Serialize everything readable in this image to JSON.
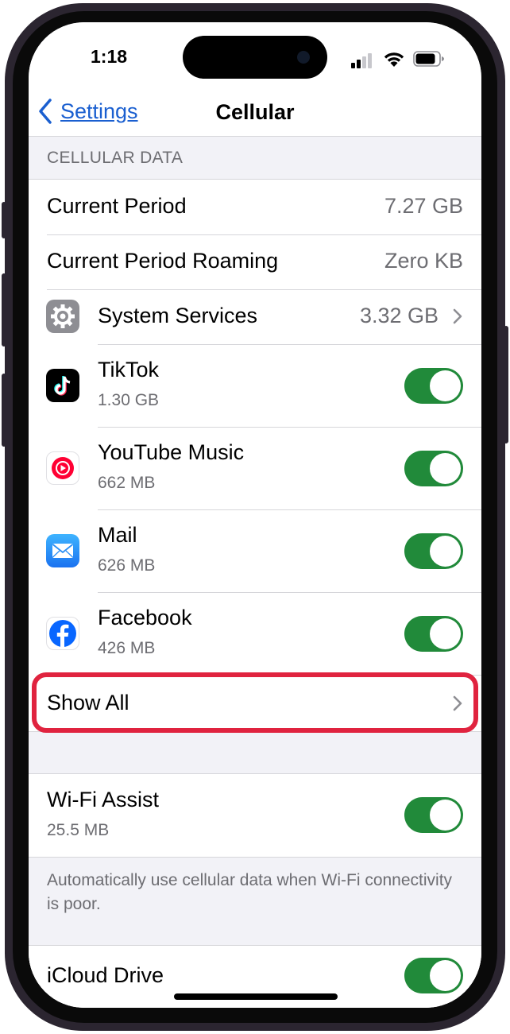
{
  "status_bar": {
    "time": "1:18"
  },
  "nav": {
    "back_label": "Settings",
    "title": "Cellular"
  },
  "section_header": "CELLULAR DATA",
  "usage_rows": [
    {
      "label": "Current Period",
      "value": "7.27 GB"
    },
    {
      "label": "Current Period Roaming",
      "value": "Zero KB"
    }
  ],
  "system_services": {
    "label": "System Services",
    "value": "3.32 GB",
    "icon": "gear-icon"
  },
  "apps": [
    {
      "name": "TikTok",
      "usage": "1.30 GB",
      "icon": "tiktok-icon",
      "enabled": true
    },
    {
      "name": "YouTube Music",
      "usage": "662 MB",
      "icon": "youtube-music-icon",
      "enabled": true
    },
    {
      "name": "Mail",
      "usage": "626 MB",
      "icon": "mail-icon",
      "enabled": true
    },
    {
      "name": "Facebook",
      "usage": "426 MB",
      "icon": "facebook-icon",
      "enabled": true
    }
  ],
  "show_all": {
    "label": "Show All"
  },
  "wifi_assist": {
    "label": "Wi-Fi Assist",
    "usage": "25.5 MB",
    "enabled": true,
    "description": "Automatically use cellular data when Wi-Fi connectivity is poor."
  },
  "icloud_drive": {
    "label": "iCloud Drive",
    "enabled": true
  },
  "colors": {
    "accent": "#1a5fd0",
    "toggle_on": "#218a3a",
    "highlight": "#e0233f"
  }
}
